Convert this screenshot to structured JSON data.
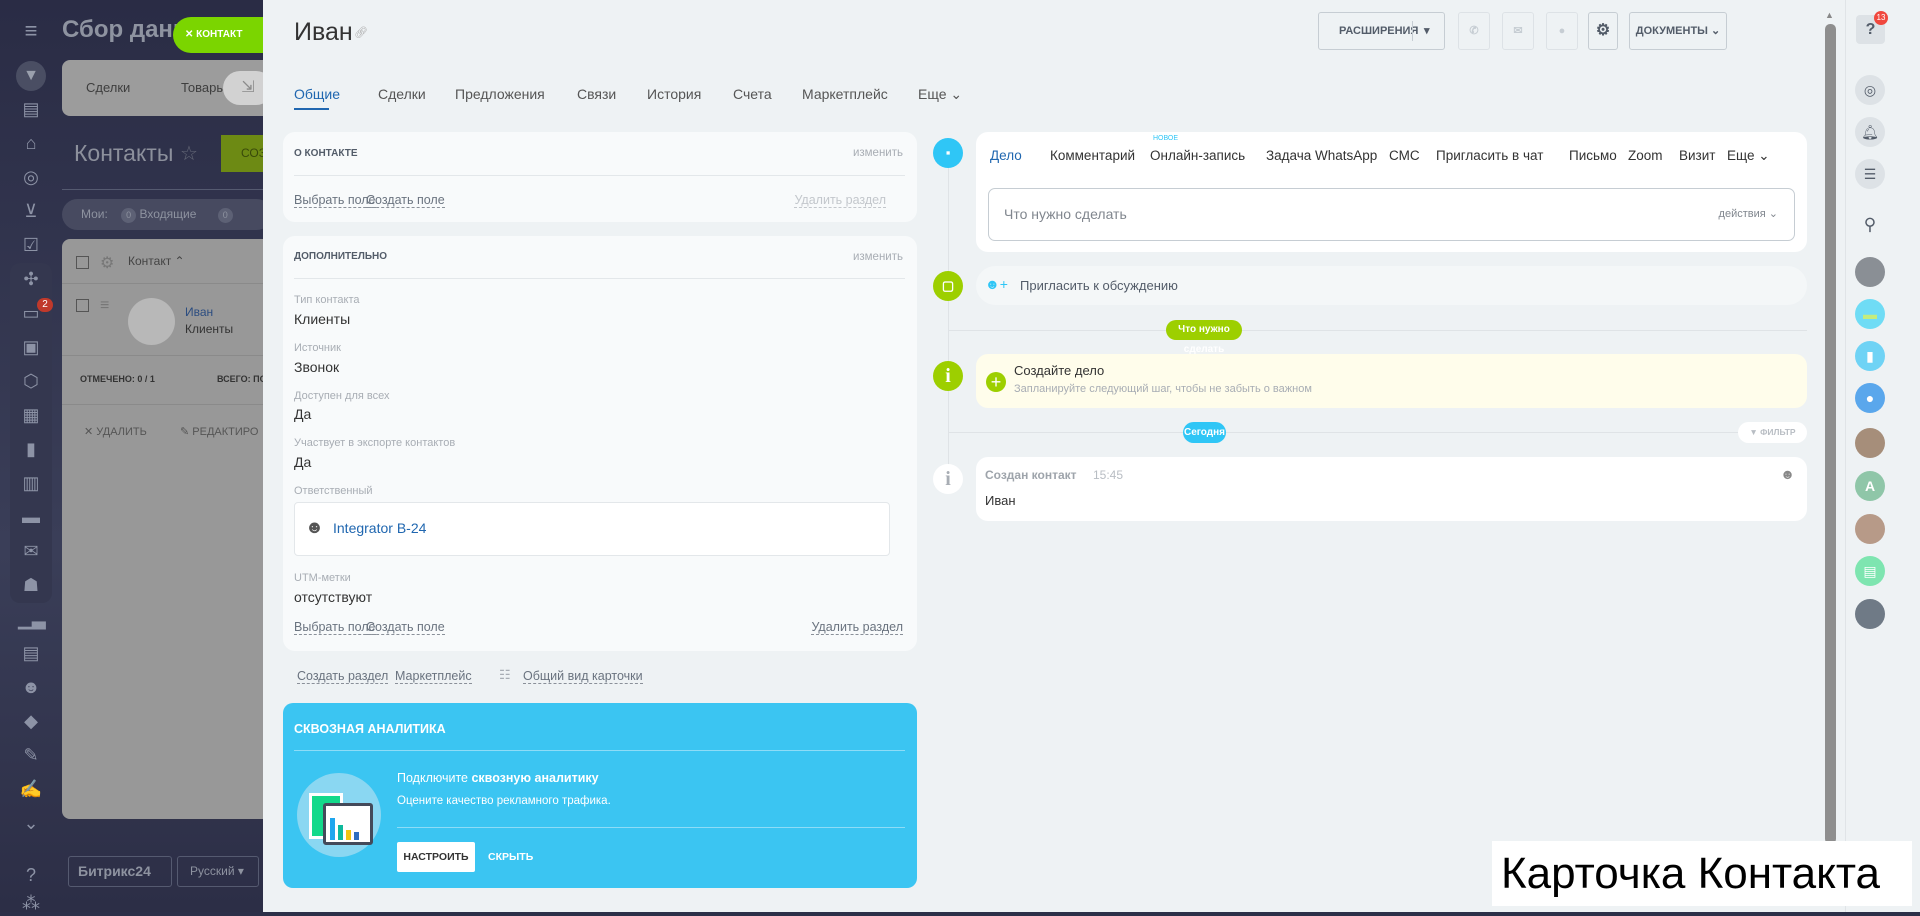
{
  "backdrop": {
    "title": "Сбор данн",
    "close_pill": "КОНТАКТ",
    "tabs": [
      "Сделки",
      "Товары"
    ],
    "page_title": "Контакты",
    "create_btn": "СОЗ",
    "filter_label": "Мои:",
    "filter_count1": "0",
    "filter_item1": "Входящие",
    "filter_count2": "0",
    "col_contact": "Контакт",
    "row_name": "Иван",
    "row_type": "Клиенты",
    "marked": "ОТМЕЧЕНО: 0 / 1",
    "total": "ВСЕГО: ПО",
    "delete": "УДАЛИТЬ",
    "edit": "РЕДАКТИРО",
    "brand": "Битрикс24",
    "lang": "Русский",
    "badge": "2"
  },
  "header": {
    "title": "Иван",
    "extensions": "РАСШИРЕНИЯ",
    "documents": "ДОКУМЕНТЫ"
  },
  "tabs": [
    "Общие",
    "Сделки",
    "Предложения",
    "Связи",
    "История",
    "Счета",
    "Маркетплейс",
    "Еще"
  ],
  "about": {
    "title": "О КОНТАКТЕ",
    "edit": "изменить",
    "select_field": "Выбрать поле",
    "create_field": "Создать поле",
    "delete_section": "Удалить раздел"
  },
  "extra": {
    "title": "ДОПОЛНИТЕЛЬНО",
    "edit": "изменить",
    "fields": [
      {
        "label": "Тип контакта",
        "value": "Клиенты"
      },
      {
        "label": "Источник",
        "value": "Звонок"
      },
      {
        "label": "Доступен для всех",
        "value": "Да"
      },
      {
        "label": "Участвует в экспорте контактов",
        "value": "Да"
      }
    ],
    "responsible_label": "Ответственный",
    "responsible": "Integrator B-24",
    "utm_label": "UTM-метки",
    "utm_value": "отсутствуют",
    "select_field": "Выбрать поле",
    "create_field": "Создать поле",
    "delete_section": "Удалить раздел"
  },
  "bottom_links": {
    "create_section": "Создать раздел",
    "marketplace": "Маркетплейс",
    "common_view": "Общий вид карточки"
  },
  "analytics": {
    "title": "СКВОЗНАЯ АНАЛИТИКА",
    "text_pre": "Подключите ",
    "text_bold": "сквозную аналитику",
    "subtext": "Оцените качество рекламного трафика.",
    "setup": "НАСТРОИТЬ",
    "hide": "СКРЫТЬ"
  },
  "composer": {
    "tabs": [
      "Дело",
      "Комментарий",
      "Онлайн-запись",
      "Задача",
      "WhatsApp",
      "СМС",
      "Пригласить в чат",
      "Письмо",
      "Zoom",
      "Визит",
      "Еще"
    ],
    "new_badge": "НОВОЕ",
    "placeholder": "Что нужно сделать",
    "actions": "действия"
  },
  "invite": "Пригласить к обсуждению",
  "todo_pill": "Что нужно сделать",
  "create_task": {
    "title": "Создайте дело",
    "subtitle": "Запланируйте следующий шаг, чтобы не забыть о важном"
  },
  "today_pill": "Сегодня",
  "filter": "ФИЛЬТР",
  "event": {
    "title": "Создан контакт",
    "time": "15:45",
    "body": "Иван"
  },
  "right_bar": {
    "help_badge": "13",
    "avatar_letter": "A"
  },
  "caption": "Карточка Контакта"
}
